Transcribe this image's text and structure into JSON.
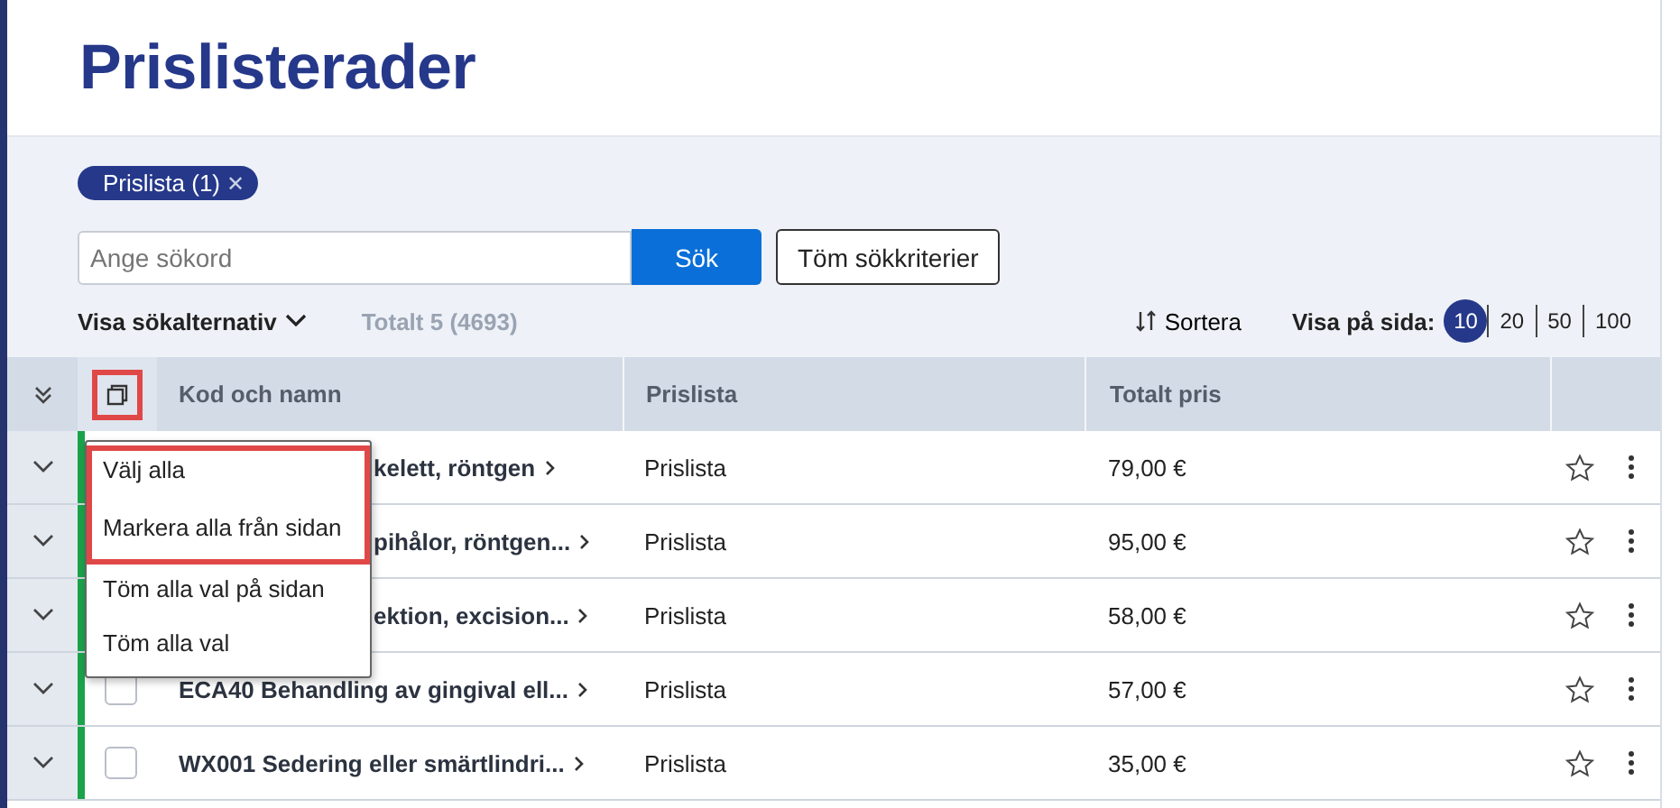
{
  "title": "Prislisterader",
  "filter_chips": [
    {
      "label": "Prislista (1)",
      "remove": "✕"
    }
  ],
  "search": {
    "placeholder": "Ange sökord",
    "button": "Sök",
    "clear_button": "Töm sökkriterier"
  },
  "options_toggle": "Visa sökalternativ",
  "total": "Totalt 5 (4693)",
  "sort": "Sortera",
  "page_size": {
    "label": "Visa på sida:",
    "options": [
      {
        "label": "10",
        "selected": true
      },
      {
        "label": "20",
        "selected": false
      },
      {
        "label": "50",
        "selected": false
      },
      {
        "label": "100",
        "selected": false
      }
    ]
  },
  "table": {
    "select_all_highlighted": true,
    "columns": [
      "Kod och namn",
      "Prislista",
      "Totalt pris"
    ],
    "rows": [
      {
        "kind": "covered",
        "name": "kelett, röntgen",
        "price_list": "Prislista",
        "total": "79,00 €"
      },
      {
        "kind": "covered",
        "name": "pihålor, röntgen...",
        "price_list": "Prislista",
        "total": "95,00 €"
      },
      {
        "kind": "covered",
        "name": "ektion, excision...",
        "price_list": "Prislista",
        "total": "58,00 €"
      },
      {
        "kind": "full",
        "checked": false,
        "name": "ECA40 Behandling av gingival ell...",
        "price_list": "Prislista",
        "total": "57,00 €"
      },
      {
        "kind": "full",
        "checked": false,
        "name": "WX001 Sedering eller smärtlindri...",
        "price_list": "Prislista",
        "total": "35,00 €"
      }
    ]
  },
  "select_menu": [
    {
      "label": "Välj alla",
      "highlighted": true
    },
    {
      "label": "Markera alla från sidan",
      "highlighted": true
    },
    {
      "label": "Töm alla val på sidan",
      "highlighted": false
    },
    {
      "label": "Töm alla val",
      "highlighted": false
    }
  ]
}
